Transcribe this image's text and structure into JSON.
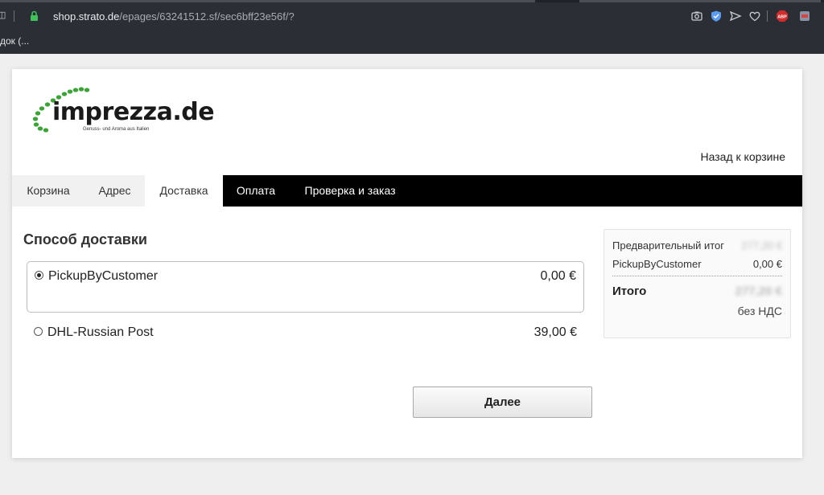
{
  "browser": {
    "url_host": "shop.strato.de",
    "url_path": "/epages/63241512.sf/sec6bff23e56f/?",
    "bookmark": "док (...",
    "extension_label": "ABP"
  },
  "shop": {
    "logo_text": "imprezza.de",
    "logo_tagline": "Genuss- und Aroma aus Italien"
  },
  "header": {
    "back_link": "Назад к корзине"
  },
  "steps": [
    {
      "label": "Корзина",
      "state": "done"
    },
    {
      "label": "Адрес",
      "state": "done"
    },
    {
      "label": "Доставка",
      "state": "current"
    },
    {
      "label": "Оплата",
      "state": "todo"
    },
    {
      "label": "Проверка и заказ",
      "state": "todo"
    }
  ],
  "shipping": {
    "title": "Способ доставки",
    "options": [
      {
        "name": "PickupByCustomer",
        "price": "0,00 €",
        "selected": true
      },
      {
        "name": "DHL-Russian Post",
        "price": "39,00 €",
        "selected": false
      }
    ],
    "next_button": "Далее"
  },
  "summary": {
    "subtotal_label": "Предварительный итог",
    "subtotal_value": "277,20 €",
    "shipping_label": "PickupByCustomer",
    "shipping_value": "0,00 €",
    "total_label": "Итого",
    "total_value": "277,20 €",
    "vat_note": "без НДС"
  },
  "colors": {
    "logo_green": "#3aa534",
    "stepbar": "#000000"
  }
}
